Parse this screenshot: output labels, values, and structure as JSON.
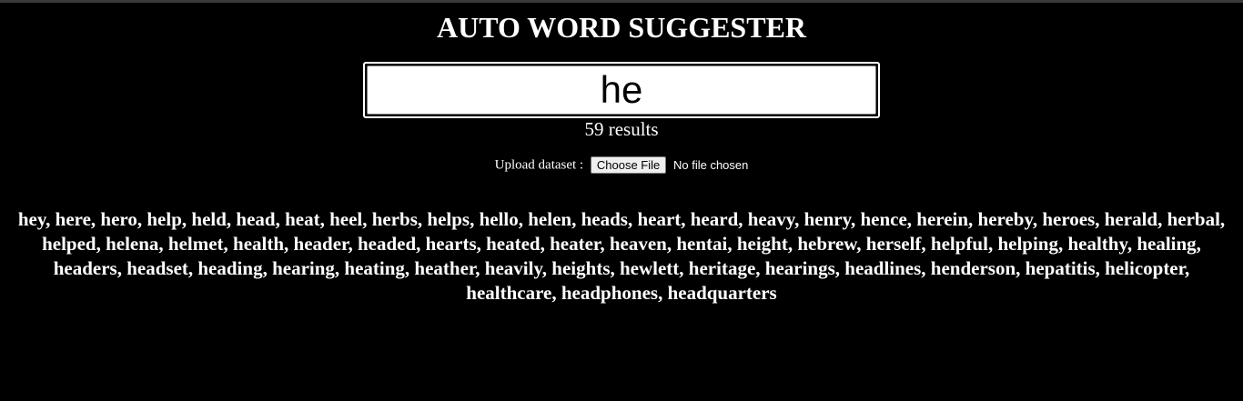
{
  "title": "AUTO WORD SUGGESTER",
  "search": {
    "value": "he"
  },
  "results": {
    "count_text": "59 results"
  },
  "upload": {
    "label": "Upload dataset :",
    "button_label": "Choose File",
    "status": "No file chosen"
  },
  "suggestions": "hey, here, hero, help, held, head, heat, heel, herbs, helps, hello, helen, heads, heart, heard, heavy, henry, hence, herein, hereby, heroes, herald, herbal, helped, helena, helmet, health, header, headed, hearts, heated, heater, heaven, hentai, height, hebrew, herself, helpful, helping, healthy, healing, headers, headset, heading, hearing, heating, heather, heavily, heights, hewlett, heritage, hearings, headlines, henderson, hepatitis, helicopter, healthcare, headphones, headquarters",
  "colors": {
    "background": "#000000",
    "text": "#ffffff",
    "input_background": "#ffffff",
    "button_background": "#efefef"
  }
}
